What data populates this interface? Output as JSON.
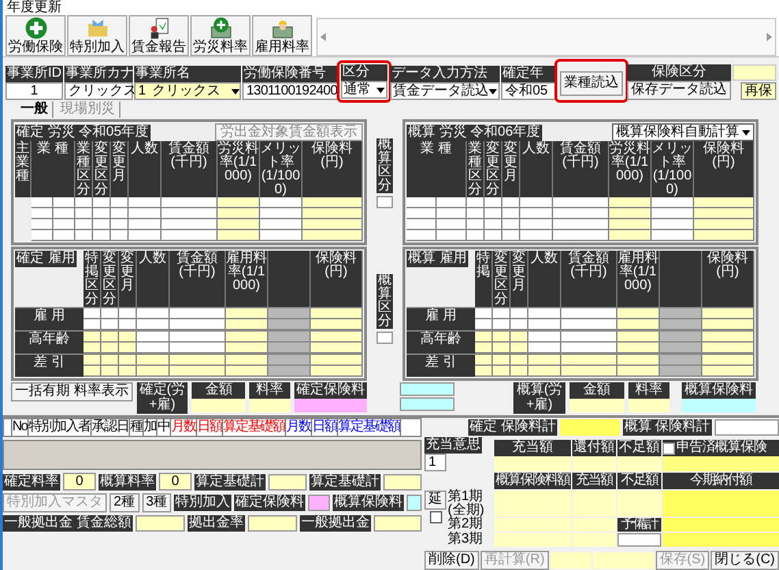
{
  "window": {
    "title": "年度更新"
  },
  "toolbar": [
    {
      "label": "労働保険",
      "kind": "plus"
    },
    {
      "label": "特別加入",
      "kind": "folder"
    },
    {
      "label": "賃金報告",
      "kind": "report"
    },
    {
      "label": "労災料率",
      "kind": "plus-table"
    },
    {
      "label": "雇用料率",
      "kind": "worker"
    }
  ],
  "office": {
    "id_label": "事業所ID",
    "id": "1",
    "kana_label": "事業所カナ",
    "kana": "クリックス",
    "name_label": "事業所名",
    "name_code": "1",
    "name": "クリックス",
    "number_label": "労働保険番号",
    "number": "1301100192400",
    "category_label": "区分",
    "category": "通常",
    "category_highlighted": true,
    "input_label": "データ入力方法",
    "input": "賃金データ読込",
    "year_label": "確定年",
    "year": "令和05",
    "load_button": "業種読込",
    "load_highlighted": true,
    "saved_button": "保存データ読込",
    "save_label": "保険区分",
    "save_value": "再保"
  },
  "tabs": [
    {
      "label": "一般",
      "selected": true
    },
    {
      "label": "現場別災",
      "selected": false
    }
  ],
  "rousai_confirmed": {
    "title": "確定 労災 令和05年度",
    "button": "労出金対象賃金額表示",
    "columns": [
      {
        "label": "主業種",
        "kind": "none"
      },
      {
        "label": "業 種",
        "kind": "split"
      },
      {
        "label": "業種区分",
        "kind": "input"
      },
      {
        "label": "変更区分",
        "kind": "input"
      },
      {
        "label": "変更月",
        "kind": "input"
      },
      {
        "label": "人数",
        "kind": "input"
      },
      {
        "label": "賃金額(千円)",
        "kind": "input"
      },
      {
        "label": "労災料率(1/1000)",
        "kind": "calc"
      },
      {
        "label": "メリット率(1/1000)",
        "kind": "input"
      },
      {
        "label": "保険料(円)",
        "kind": "calc"
      }
    ]
  },
  "rousai_estimated": {
    "title": "概算 労災 令和06年度",
    "dropdown": "概算保険料自動計算",
    "columns": [
      {
        "label": "業 種",
        "kind": "split"
      },
      {
        "label": "業種区分",
        "kind": "input"
      },
      {
        "label": "変更区分",
        "kind": "input"
      },
      {
        "label": "変更月",
        "kind": "input"
      },
      {
        "label": "人数",
        "kind": "input"
      },
      {
        "label": "賃金額(千円)",
        "kind": "input"
      },
      {
        "label": "労災料率(1/1000)",
        "kind": "calc"
      },
      {
        "label": "メリット率(1/1000)",
        "kind": "input"
      },
      {
        "label": "保険料(円)",
        "kind": "calc"
      }
    ]
  },
  "middle_labels": [
    "概算区分",
    "概算区分"
  ],
  "koyou_confirmed": {
    "title": "確定 雇用",
    "columns": [
      {
        "label": "特掲区分"
      },
      {
        "label": "変更区分"
      },
      {
        "label": "変更月"
      },
      {
        "label": "人数"
      },
      {
        "label": "賃金額(千円)"
      },
      {
        "label": "雇用料率(1/1000)"
      },
      {},
      {
        "label": "保険料(円)"
      }
    ],
    "groups": [
      {
        "label": "雇 用",
        "cells": [
          {
            "kind": "input"
          },
          {
            "kind": "input"
          },
          {
            "kind": "input"
          },
          {
            "kind": "input"
          },
          {
            "kind": "input"
          },
          {
            "kind": "calc"
          },
          {
            "kind": "blank"
          },
          {
            "kind": "calc"
          }
        ]
      },
      {
        "label": "高年齢",
        "cells": [
          {
            "kind": "calc"
          },
          {
            "kind": "calc"
          },
          {
            "kind": "calc"
          },
          {
            "kind": "input"
          },
          {
            "kind": "input"
          },
          {
            "kind": "calc"
          },
          {
            "kind": "blank"
          },
          {
            "kind": "calc"
          }
        ]
      },
      {
        "label": "差 引",
        "cells": [
          {
            "kind": "calc"
          },
          {
            "kind": "calc"
          },
          {
            "kind": "calc"
          },
          {
            "kind": "calc"
          },
          {
            "kind": "calc"
          },
          {
            "kind": "calc"
          },
          {
            "kind": "blank"
          },
          {
            "kind": "calc"
          }
        ]
      }
    ]
  },
  "koyou_estimated": {
    "title": "概算 雇用",
    "columns": [
      {
        "label": "特掲"
      },
      {
        "label": "変更区分"
      },
      {
        "label": "変更月"
      },
      {
        "label": "人数"
      },
      {
        "label": "賃金額(千円)"
      },
      {
        "label": "雇用料率(1/1000)"
      },
      {},
      {
        "label": "保険料(円)"
      }
    ],
    "groups": [
      {
        "label": "雇 用",
        "cells": [
          {
            "kind": "input"
          },
          {
            "kind": "input"
          },
          {
            "kind": "input"
          },
          {
            "kind": "input"
          },
          {
            "kind": "input"
          },
          {
            "kind": "calc"
          },
          {
            "kind": "blank"
          },
          {
            "kind": "calc"
          }
        ]
      },
      {
        "label": "高年齢",
        "cells": [
          {
            "kind": "calc"
          },
          {
            "kind": "calc"
          },
          {
            "kind": "calc"
          },
          {
            "kind": "input"
          },
          {
            "kind": "input"
          },
          {
            "kind": "calc"
          },
          {
            "kind": "blank"
          },
          {
            "kind": "calc"
          }
        ]
      },
      {
        "label": "差 引",
        "cells": [
          {
            "kind": "calc"
          },
          {
            "kind": "calc"
          },
          {
            "kind": "calc"
          },
          {
            "kind": "calc"
          },
          {
            "kind": "calc"
          },
          {
            "kind": "calc"
          },
          {
            "kind": "blank"
          },
          {
            "kind": "calc"
          }
        ]
      }
    ]
  },
  "summary_confirmed": {
    "button": "一括有期 料率表示",
    "label": "確定(労+雇)",
    "amount_label": "金額",
    "rate_label": "料率",
    "premium_label": "確定保険料"
  },
  "summary_estimated": {
    "label": "概算(労+雇)",
    "amount_label": "金額",
    "rate_label": "料率",
    "premium_label": "概算保険料"
  },
  "special": {
    "columns": [
      {
        "label": "No",
        "color": "#000000"
      },
      {
        "label": "特別加入者",
        "color": "#000000"
      },
      {
        "label": "承認日",
        "color": "#000000"
      },
      {
        "label": "種",
        "color": "#000000"
      },
      {
        "label": "加",
        "color": "#000000"
      },
      {
        "label": "中",
        "color": "#000000"
      },
      {
        "label": "月数",
        "color": "#ff0000"
      },
      {
        "label": "日額",
        "color": "#ff0000"
      },
      {
        "label": "算定基礎額",
        "color": "#ff0000"
      },
      {
        "label": "月数",
        "color": "#0000ff"
      },
      {
        "label": "日額",
        "color": "#0000ff"
      },
      {
        "label": "算定基礎額",
        "color": "#0000ff"
      }
    ]
  },
  "special_totals": {
    "confirmed_rate_label": "確定料率",
    "confirmed_rate": "0",
    "estimated_rate_label": "概算料率",
    "estimated_rate": "0",
    "base_total_label": "算定基礎計",
    "base_total_label_2": "算定基礎計",
    "master_button": "特別加入マスタ",
    "type2_button": "2種",
    "type3_button": "3種",
    "special_label": "特別加入",
    "confirmed_premium_label": "確定保険料",
    "estimated_premium_label": "概算保険料",
    "contribution_label": "一般拠出金 賃金総額",
    "contribution_rate_label": "拠出金率",
    "contribution_total_label": "一般拠出金"
  },
  "totals": {
    "confirmed_label": "確定 保険料計",
    "estimated_label": "概算 保険料計"
  },
  "allocation": {
    "label": "充当意思",
    "value": "1",
    "headers": [
      "充当額",
      "還付額",
      "不足額"
    ],
    "declared_label": "申告済概算保険",
    "declared_checked": false
  },
  "installments": {
    "headers": [
      "概算保険料額",
      "充当額",
      "不足額",
      "今期納付額"
    ],
    "rows": [
      {
        "label": "第1期(全期)"
      },
      {
        "label": "第2期"
      },
      {
        "label": "第3期"
      }
    ],
    "reserve_label": "予備計",
    "extend_button": "延",
    "extend_checked": false
  },
  "footer": [
    {
      "label": "削除(D)",
      "disabled": false
    },
    {
      "label": "再計算(R)",
      "disabled": true
    },
    {
      "label": "保存(S)",
      "disabled": true
    },
    {
      "label": "閉じる(C)",
      "disabled": false
    }
  ]
}
